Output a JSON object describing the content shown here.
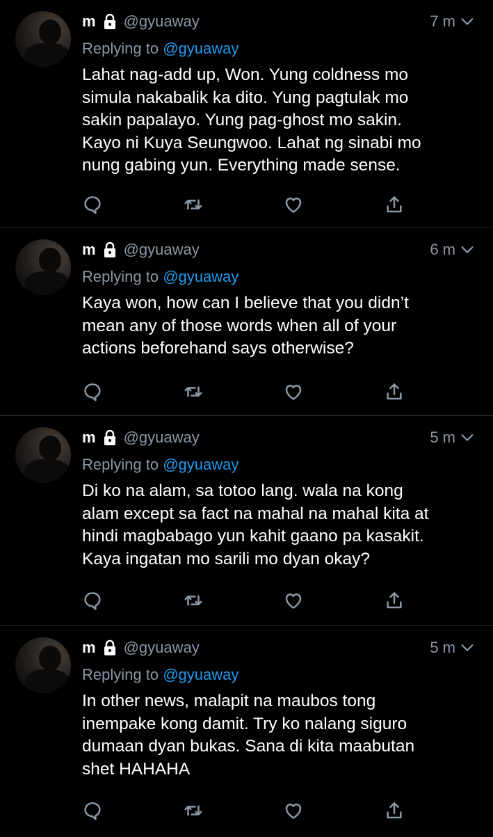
{
  "tweets": [
    {
      "name": "m",
      "handle": "@gyuaway",
      "time": "7 m",
      "replying_prefix": "Replying to ",
      "replying_handle": "@gyuaway",
      "text": "Lahat nag-add up, Won. Yung coldness mo\nsimula nakabalik ka dito. Yung pagtulak mo\nsakin papalayo. Yung pag-ghost mo sakin.\nKayo ni Kuya Seungwoo. Lahat ng sinabi mo\nnung gabing yun. Everything made sense."
    },
    {
      "name": "m",
      "handle": "@gyuaway",
      "time": "6 m",
      "replying_prefix": "Replying to ",
      "replying_handle": "@gyuaway",
      "text": "Kaya won, how can I believe that you didn’t\nmean any of those words when all of your\nactions beforehand says otherwise?"
    },
    {
      "name": "m",
      "handle": "@gyuaway",
      "time": "5 m",
      "replying_prefix": "Replying to ",
      "replying_handle": "@gyuaway",
      "text": "Di ko na alam, sa totoo lang. wala na kong\nalam except sa fact na mahal na mahal kita at\nhindi magbabago yun kahit gaano pa kasakit.\nKaya ingatan mo sarili mo dyan okay?"
    },
    {
      "name": "m",
      "handle": "@gyuaway",
      "time": "5 m",
      "replying_prefix": "Replying to ",
      "replying_handle": "@gyuaway",
      "text": "In other news, malapit na maubos tong\ninempake kong damit. Try ko nalang siguro\ndumaan dyan bukas. Sana di kita maabutan\nshet HAHAHA"
    }
  ],
  "icons": {
    "lock": "lock-icon",
    "chevron": "chevron-down-icon",
    "reply": "reply-icon",
    "retweet": "retweet-icon",
    "like": "like-icon",
    "share": "share-icon"
  },
  "colors": {
    "background": "#000000",
    "text": "#ffffff",
    "secondary": "#8b98a5",
    "mention": "#1d9bf0",
    "divider": "#2f3336"
  }
}
